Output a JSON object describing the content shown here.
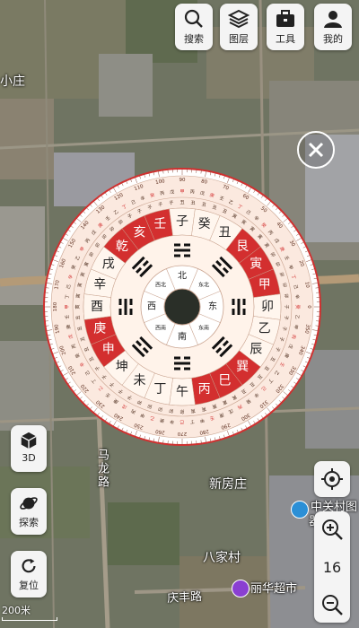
{
  "toolbar": [
    {
      "label": "搜索",
      "icon": "search-icon"
    },
    {
      "label": "图层",
      "icon": "layers-icon"
    },
    {
      "label": "工具",
      "icon": "toolbox-icon"
    },
    {
      "label": "我的",
      "icon": "user-icon"
    }
  ],
  "side_buttons": {
    "three_d": "3D",
    "explore": "探索",
    "reset": "复位"
  },
  "zoom_level": "16",
  "scale_text": "200米",
  "map_labels": {
    "place1": "小庄",
    "place2": "新房庄",
    "place3": "八家村",
    "place4": "中关村图",
    "place4b": "器馆",
    "supermarket": "丽华超市",
    "road1": "马龙路",
    "road2": "庆丰路"
  },
  "compass": {
    "center_directions": [
      "东",
      "东南",
      "南",
      "西南",
      "西",
      "西北",
      "北",
      "东北"
    ],
    "trigram_ring": [
      "震",
      "巽",
      "离",
      "坤",
      "兑",
      "乾",
      "坎",
      "艮"
    ],
    "mountains": [
      "卯",
      "乙",
      "辰",
      "巽",
      "巳",
      "丙",
      "午",
      "丁",
      "未",
      "坤",
      "申",
      "庚",
      "酉",
      "辛",
      "戌",
      "乾",
      "亥",
      "壬",
      "子",
      "癸",
      "丑",
      "艮",
      "寅",
      "甲"
    ],
    "red_mountains": [
      "巽",
      "巳",
      "丙",
      "申",
      "庚",
      "乾",
      "亥",
      "壬",
      "艮",
      "寅",
      "甲"
    ],
    "degree_labels": [
      "0",
      "10",
      "20",
      "30",
      "40",
      "50",
      "60",
      "70",
      "80",
      "90",
      "100",
      "110",
      "120",
      "130",
      "140",
      "150",
      "160",
      "170",
      "180",
      "190",
      "200",
      "210",
      "220",
      "230",
      "240",
      "250",
      "260",
      "270",
      "280",
      "290",
      "300",
      "310",
      "320",
      "330",
      "340",
      "350"
    ],
    "ring_chars": [
      "甲子",
      "丙子",
      "戊子",
      "庚子",
      "壬子",
      "乙丑",
      "丁丑",
      "己丑",
      "辛丑",
      "癸丑",
      "丙寅",
      "戊寅",
      "庚寅",
      "壬寅",
      "甲寅",
      "丁卯",
      "己卯",
      "辛卯",
      "癸卯",
      "乙卯"
    ]
  },
  "colors": {
    "accent_red": "#d32f2f",
    "compass_bg": "#fbe9df",
    "compass_cream": "#fff6ee"
  }
}
